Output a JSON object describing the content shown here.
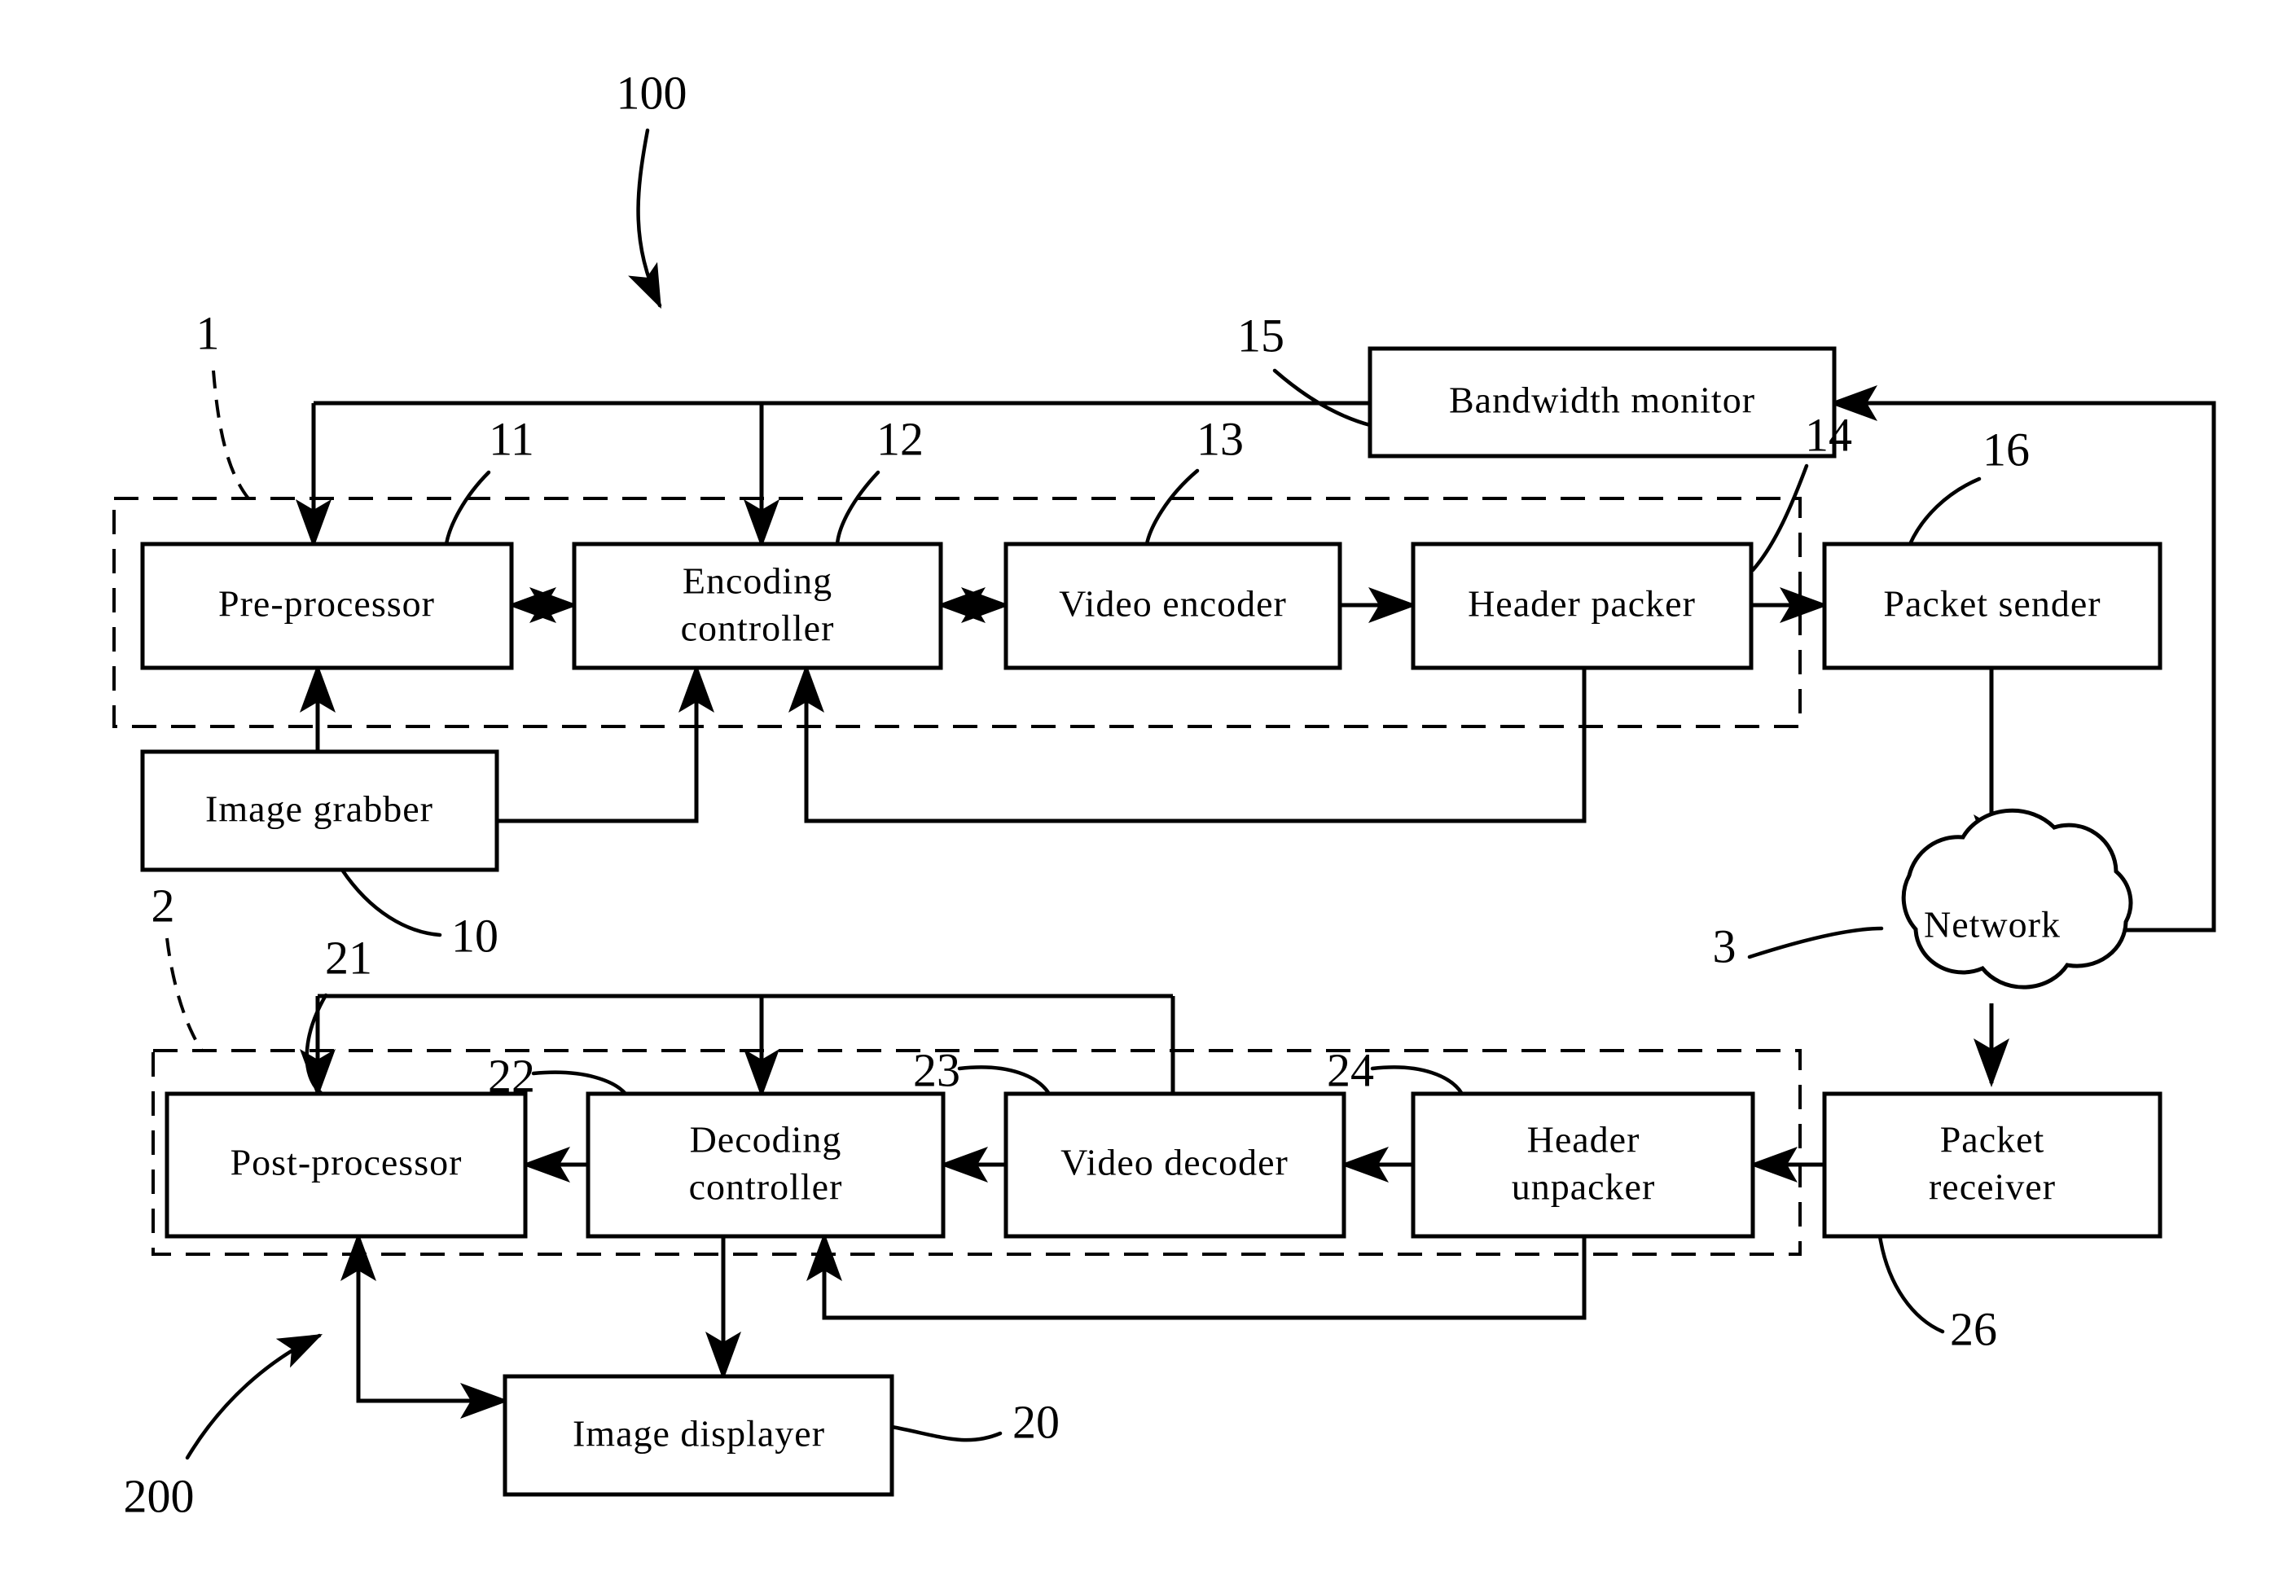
{
  "figure": {
    "type": "patent-block-diagram",
    "title_numeral": "100",
    "background": "#ffffff",
    "line_color": "#000000"
  },
  "blocks": {
    "bandwidth_monitor": "Bandwidth monitor",
    "pre_processor": "Pre-processor",
    "encoding_controller_line1": "Encoding",
    "encoding_controller_line2": "controller",
    "video_encoder": "Video encoder",
    "header_packer": "Header packer",
    "packet_sender": "Packet sender",
    "image_grabber": "Image grabber",
    "network": "Network",
    "post_processor": "Post-processor",
    "decoding_controller_line1": "Decoding",
    "decoding_controller_line2": "controller",
    "video_decoder": "Video decoder",
    "header_unpacker_line1": "Header",
    "header_unpacker_line2": "unpacker",
    "packet_receiver_line1": "Packet",
    "packet_receiver_line2": "receiver",
    "image_displayer": "Image displayer"
  },
  "reference_numerals": {
    "system": "100",
    "transmitter_group": "1",
    "image_grabber": "10",
    "pre_processor": "11",
    "encoding_controller": "12",
    "video_encoder": "13",
    "header_packer": "14",
    "bandwidth_monitor": "15",
    "packet_sender": "16",
    "receiver_group": "2",
    "image_displayer": "20",
    "post_processor": "21",
    "decoding_controller": "22",
    "video_decoder": "23",
    "header_unpacker": "24",
    "packet_receiver": "26",
    "network": "3",
    "receiver_system": "200"
  }
}
